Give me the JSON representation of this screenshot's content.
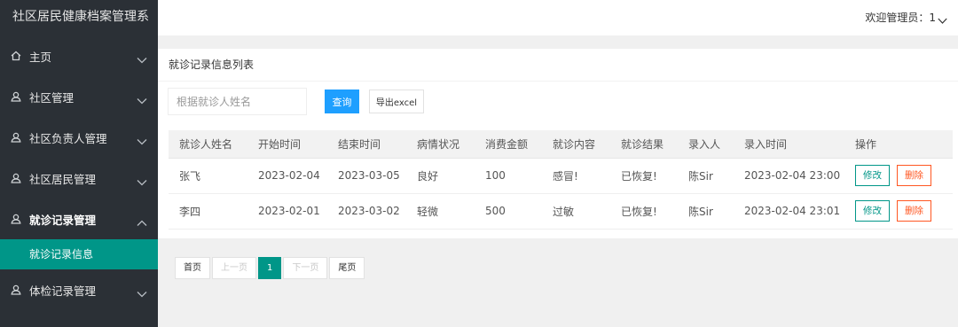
{
  "app": {
    "title": "社区居民健康档案管理系"
  },
  "header": {
    "welcome": "欢迎管理员：1"
  },
  "sidebar": {
    "items": [
      {
        "label": "主页",
        "icon": "home-icon"
      },
      {
        "label": "社区管理",
        "icon": "user-icon"
      },
      {
        "label": "社区负责人管理",
        "icon": "user-icon"
      },
      {
        "label": "社区居民管理",
        "icon": "user-icon"
      },
      {
        "label": "就诊记录管理",
        "icon": "user-icon",
        "open": true
      },
      {
        "label": "体检记录管理",
        "icon": "user-icon"
      }
    ],
    "subitem": {
      "label": "就诊记录信息"
    }
  },
  "main": {
    "title": "就诊记录信息列表",
    "search": {
      "placeholder": "根据就诊人姓名",
      "value": ""
    },
    "query_label": "查询",
    "export_label": "导出excel",
    "columns": [
      "就诊人姓名",
      "开始时间",
      "结束时间",
      "病情状况",
      "消费金额",
      "就诊内容",
      "就诊结果",
      "录入人",
      "录入时间",
      "操作"
    ],
    "rows": [
      [
        "张飞",
        "2023-02-04",
        "2023-03-05",
        "良好",
        "100",
        "感冒!",
        "已恢复!",
        "陈Sir",
        "2023-02-04 23:00"
      ],
      [
        "李四",
        "2023-02-01",
        "2023-03-02",
        "轻微",
        "500",
        "过敏",
        "已恢复!",
        "陈Sir",
        "2023-02-04 23:01"
      ]
    ],
    "edit_label": "修改",
    "delete_label": "删除"
  },
  "pagination": {
    "first": "首页",
    "prev": "上一页",
    "current": "1",
    "next": "下一页",
    "last": "尾页"
  },
  "colors": {
    "sidebar_bg": "#2b3036",
    "accent": "#009688",
    "query_btn": "#1e9fff",
    "delete": "#ff5722"
  }
}
